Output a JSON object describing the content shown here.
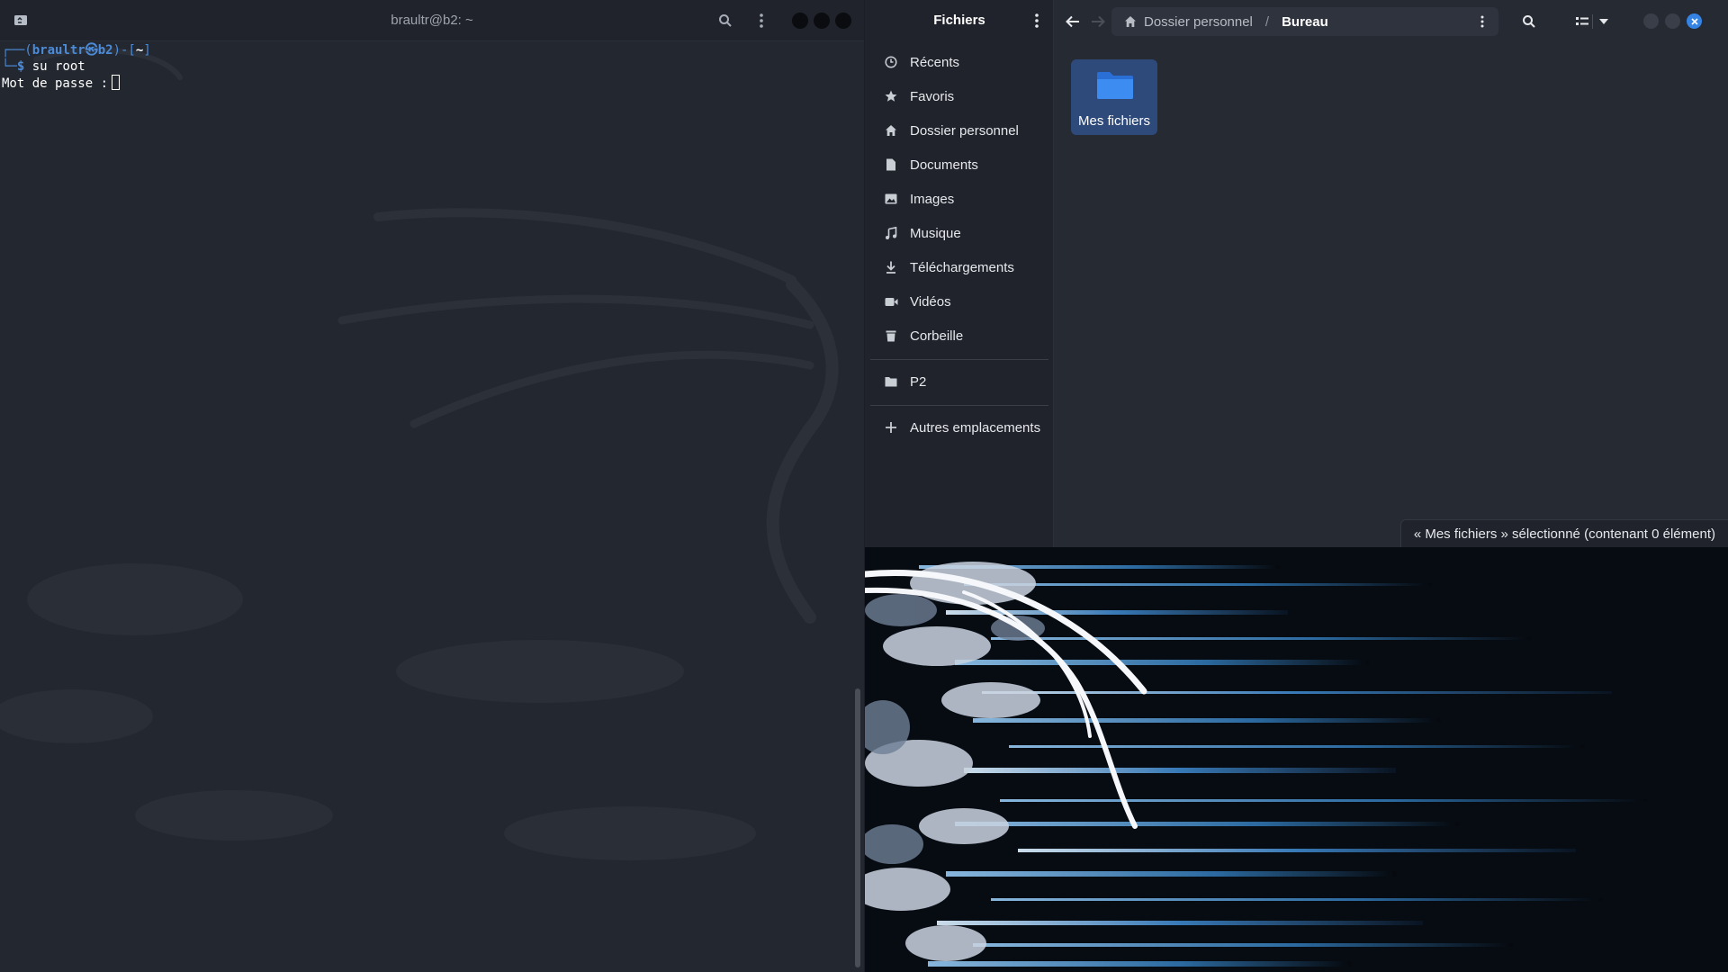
{
  "terminal": {
    "title": "braultr@b2: ~",
    "prompt_open": "┌──(",
    "prompt_user": "braultr㉿b2",
    "prompt_close": ")-[",
    "prompt_dir": "~",
    "prompt_end": "]",
    "cmd_prefix": "└─",
    "cmd_dollar": "$",
    "command": " su root",
    "password_label": "Mot de passe :",
    "icons": [
      "new-tab-icon",
      "search-icon",
      "kebab-menu-icon",
      "minimize-icon",
      "maximize-icon",
      "close-icon"
    ]
  },
  "files": {
    "title": "Fichiers",
    "sidebar": {
      "items": [
        {
          "label": "Récents",
          "icon": "clock-icon"
        },
        {
          "label": "Favoris",
          "icon": "star-icon"
        },
        {
          "label": "Dossier personnel",
          "icon": "home-icon"
        },
        {
          "label": "Documents",
          "icon": "document-icon"
        },
        {
          "label": "Images",
          "icon": "image-icon"
        },
        {
          "label": "Musique",
          "icon": "music-icon"
        },
        {
          "label": "Téléchargements",
          "icon": "download-icon"
        },
        {
          "label": "Vidéos",
          "icon": "video-icon"
        },
        {
          "label": "Corbeille",
          "icon": "trash-icon"
        }
      ],
      "bookmarks": [
        {
          "label": "P2",
          "icon": "folder-icon"
        }
      ],
      "other": {
        "label": "Autres emplacements",
        "icon": "plus-icon"
      }
    },
    "pathbar": {
      "crumbs": [
        "Dossier personnel",
        "/",
        "Bureau"
      ]
    },
    "items": [
      {
        "label": "Mes fichiers",
        "icon": "folder-icon",
        "selected": true
      }
    ],
    "status": "« Mes fichiers » sélectionné  (contenant 0 élément)"
  },
  "colors": {
    "accent": "#3584e4",
    "terminal_bg": "#232730",
    "prompt_blue": "#4b8bd8"
  }
}
